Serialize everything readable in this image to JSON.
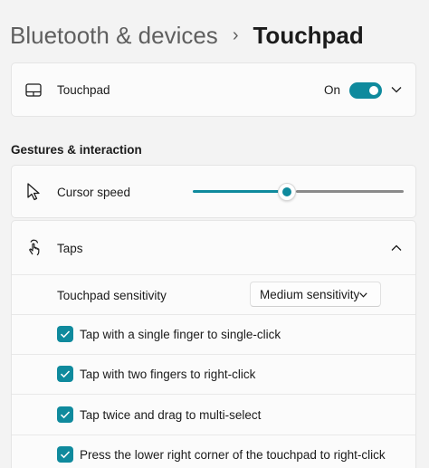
{
  "breadcrumb": {
    "parent": "Bluetooth & devices",
    "separator": "›",
    "current": "Touchpad"
  },
  "touchpad_card": {
    "icon": "touchpad-icon",
    "label": "Touchpad",
    "toggle_state": "On",
    "toggle_on": true
  },
  "section": {
    "title": "Gestures & interaction"
  },
  "cursor_speed": {
    "icon": "pointer-icon",
    "label": "Cursor speed",
    "value_fraction": 0.45
  },
  "taps": {
    "icon": "tap-gesture-icon",
    "label": "Taps",
    "expanded": true,
    "sensitivity_label": "Touchpad sensitivity",
    "sensitivity_value": "Medium sensitivity",
    "options": [
      {
        "label": "Tap with a single finger to single-click",
        "checked": true
      },
      {
        "label": "Tap with two fingers to right-click",
        "checked": true
      },
      {
        "label": "Tap twice and drag to multi-select",
        "checked": true
      },
      {
        "label": "Press the lower right corner of the touchpad to right-click",
        "checked": true
      }
    ]
  },
  "colors": {
    "accent": "#0f8a9d",
    "background": "#f3f3f3",
    "card": "#fbfbfb"
  }
}
